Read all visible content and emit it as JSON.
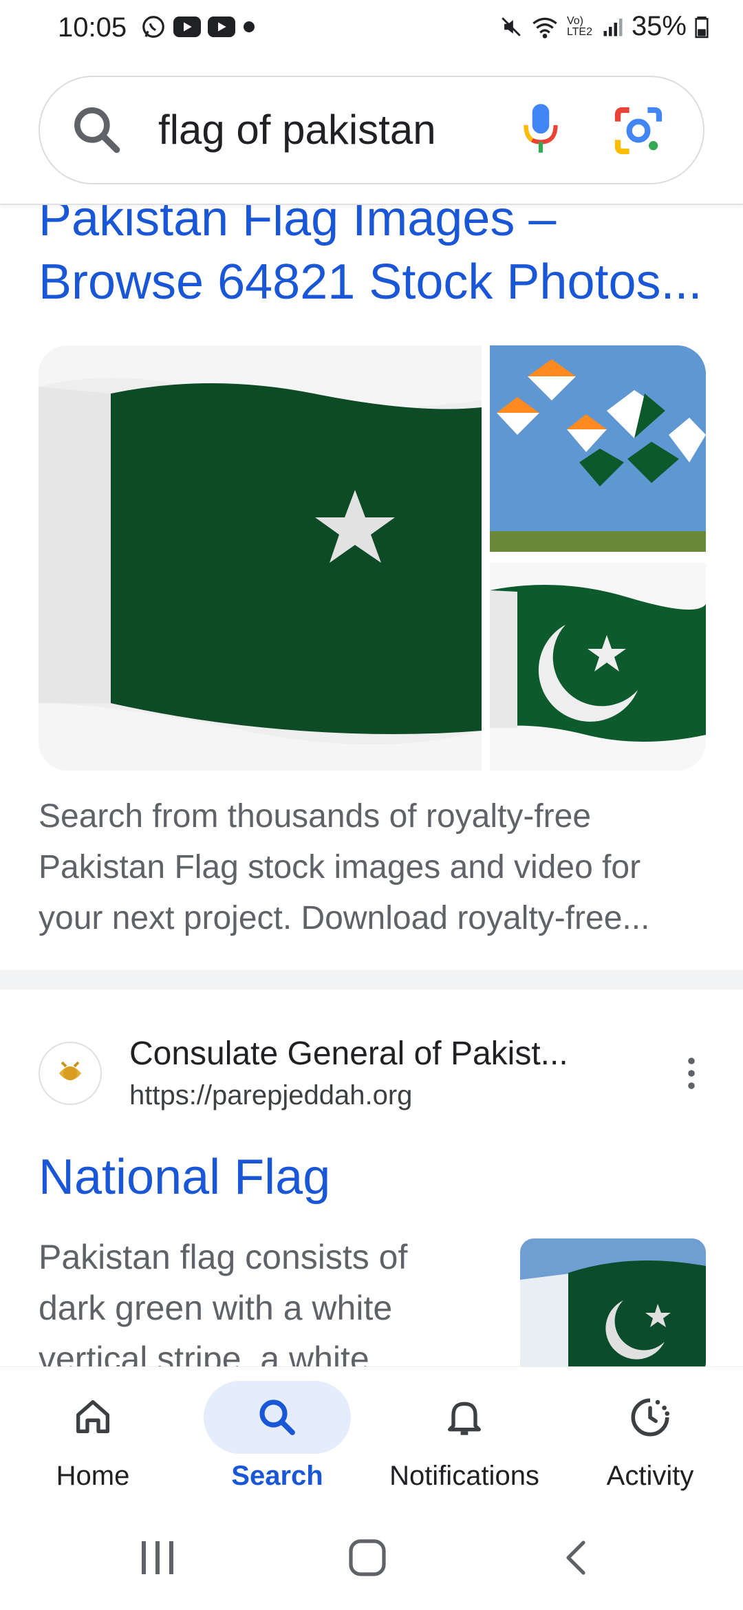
{
  "status_bar": {
    "time": "10:05",
    "battery": "35%",
    "network_label": "Vo) LTE2"
  },
  "search": {
    "query": "flag of pakistan"
  },
  "result1": {
    "title_line1": "Pakistan Flag Images –",
    "title_line2": "Browse 64821 Stock Photos...",
    "snippet": "Search from thousands of royalty-free Pakistan Flag stock images and video for your next project. Download royalty-free..."
  },
  "result2": {
    "site_name": "Consulate General of Pakist...",
    "url": "https://parepjeddah.org",
    "title": "National Flag",
    "snippet": "Pakistan flag consists of dark green with a white vertical stripe, a white"
  },
  "bottom_nav": {
    "items": [
      {
        "label": "Home"
      },
      {
        "label": "Search"
      },
      {
        "label": "Notifications"
      },
      {
        "label": "Activity"
      }
    ]
  },
  "colors": {
    "link": "#1a57d6",
    "active_pill": "#e5ecfb",
    "flag_green": "#0b4d2a"
  }
}
